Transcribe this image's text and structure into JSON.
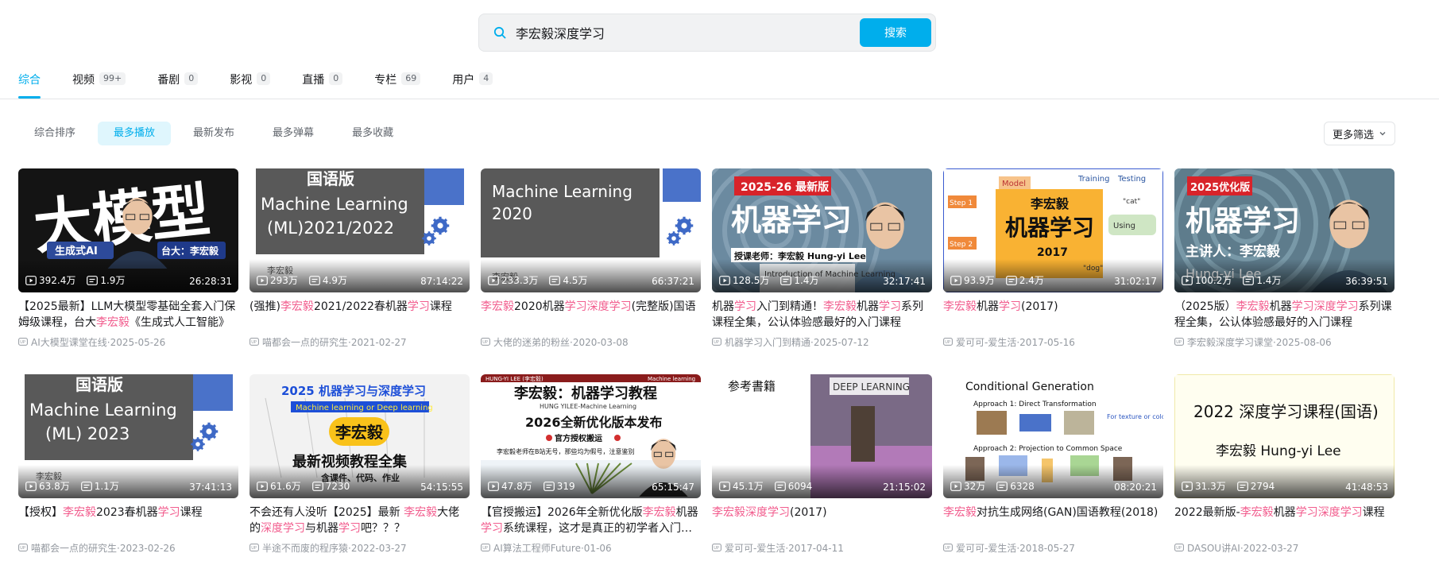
{
  "search": {
    "value": "李宏毅深度学习",
    "button": "搜索"
  },
  "tabs": [
    {
      "label": "综合",
      "count": ""
    },
    {
      "label": "视频",
      "count": "99+"
    },
    {
      "label": "番剧",
      "count": "0"
    },
    {
      "label": "影视",
      "count": "0"
    },
    {
      "label": "直播",
      "count": "0"
    },
    {
      "label": "专栏",
      "count": "69"
    },
    {
      "label": "用户",
      "count": "4"
    }
  ],
  "sort": [
    "综合排序",
    "最多播放",
    "最新发布",
    "最多弹幕",
    "最多收藏"
  ],
  "filter_label": "更多筛选",
  "colors": {
    "accent": "#00aeec",
    "highlight": "#f25d8e"
  },
  "videos": [
    {
      "views": "392.4万",
      "danmaku": "1.9万",
      "duration": "26:28:31",
      "title": [
        [
          "【2025最新】LLM大模型零基础全套入门保姆级课程，台大",
          ""
        ],
        [
          "李宏毅",
          "h"
        ],
        [
          "《生成式人工智能》",
          ""
        ]
      ],
      "uploader": "AI大模型课堂在线",
      "date": "2025-05-26",
      "thumb": {
        "bg": "#111111",
        "big": "大模型",
        "sub": "生成式AI",
        "tag": "台大：李宏毅"
      }
    },
    {
      "views": "293万",
      "danmaku": "4.9万",
      "duration": "87:14:22",
      "title": [
        [
          "(强推)",
          ""
        ],
        [
          "李宏毅",
          "h"
        ],
        [
          "2021/2022春机器",
          ""
        ],
        [
          "学习",
          "h"
        ],
        [
          "课程",
          ""
        ]
      ],
      "uploader": "喵都会一点的研究生",
      "date": "2021-02-27",
      "thumb": {
        "top": "国语版",
        "line1": "Machine Learning",
        "line2": "(ML)2021/2022",
        "caption": "李宏毅"
      }
    },
    {
      "views": "233.3万",
      "danmaku": "4.5万",
      "duration": "66:37:21",
      "title": [
        [
          "李宏毅",
          "h"
        ],
        [
          "2020机器",
          ""
        ],
        [
          "学习",
          "h"
        ],
        [
          "深度",
          "h"
        ],
        [
          "学习",
          "h"
        ],
        [
          "(完整版)国语",
          ""
        ]
      ],
      "uploader": "大佬的迷弟的粉丝",
      "date": "2020-03-08",
      "thumb": {
        "line1": "Machine Learning",
        "line2": "2020",
        "caption": "李宏毅"
      }
    },
    {
      "views": "128.5万",
      "danmaku": "1.4万",
      "duration": "32:17:41",
      "title": [
        [
          "机器",
          ""
        ],
        [
          "学习",
          "h"
        ],
        [
          "入门到精通！",
          ""
        ],
        [
          "李宏毅",
          "h"
        ],
        [
          "机器",
          ""
        ],
        [
          "学习",
          "h"
        ],
        [
          "系列课程全集，公认体验感最好的入门课程",
          ""
        ]
      ],
      "uploader": "机器学习入门到精通",
      "date": "2025-07-12",
      "thumb": {
        "badge": "2025-26 最新版",
        "big": "机器学习",
        "teacher": "授课老师：李宏毅 Hung-yi Lee",
        "intro": "Introduction of Machine Learning"
      }
    },
    {
      "views": "93.9万",
      "danmaku": "2.4万",
      "duration": "31:02:17",
      "title": [
        [
          "李宏毅",
          "h"
        ],
        [
          "机器",
          ""
        ],
        [
          "学习",
          "h"
        ],
        [
          "(2017)",
          ""
        ]
      ],
      "uploader": "爱可可-爱生活",
      "date": "2017-05-16",
      "thumb": {
        "name": "李宏毅",
        "big": "机器学习",
        "year": "2017",
        "step1": "Step 1",
        "step2": "Step 2",
        "model": "Model",
        "training": "Training",
        "testing": "Testing",
        "cat": "\"cat\"",
        "dog": "\"dog\"",
        "using": "Using"
      }
    },
    {
      "views": "100.2万",
      "danmaku": "1.4万",
      "duration": "36:39:51",
      "title": [
        [
          "（2025版）",
          ""
        ],
        [
          "李宏毅",
          "h"
        ],
        [
          "机器",
          ""
        ],
        [
          "学习",
          "h"
        ],
        [
          "深度",
          "h"
        ],
        [
          "学习",
          "h"
        ],
        [
          "系列课程全集，公认体验感最好的入门课程",
          ""
        ]
      ],
      "uploader": "李宏毅深度学习课堂",
      "date": "2025-08-06",
      "thumb": {
        "badge": "2025优化版",
        "big": "机器学习",
        "teacher": "主讲人：李宏毅",
        "en": "Hung-yi Lee"
      }
    },
    {
      "views": "63.8万",
      "danmaku": "1.1万",
      "duration": "37:41:13",
      "title": [
        [
          "【授权】",
          ""
        ],
        [
          "李宏毅",
          "h"
        ],
        [
          "2023春机器",
          ""
        ],
        [
          "学习",
          "h"
        ],
        [
          "课程",
          ""
        ]
      ],
      "uploader": "喵都会一点的研究生",
      "date": "2023-02-26",
      "thumb": {
        "top": "国语版",
        "line1": "Machine Learning",
        "line2": "(ML) 2023",
        "caption": "李宏毅"
      }
    },
    {
      "views": "61.6万",
      "danmaku": "7230",
      "duration": "54:15:55",
      "title": [
        [
          "不会还有人没听【2025】最新 ",
          ""
        ],
        [
          "李宏毅",
          "h"
        ],
        [
          "大佬的",
          ""
        ],
        [
          "深度",
          "h"
        ],
        [
          "学习",
          "h"
        ],
        [
          "与机器",
          ""
        ],
        [
          "学习",
          "h"
        ],
        [
          "吧？？？",
          ""
        ]
      ],
      "uploader": "半途不而废的程序猿",
      "date": "2022-03-27",
      "thumb": {
        "top": "2025 机器学习与深度学习",
        "sub": "Machine learning or Deep learning",
        "name": "李宏毅",
        "big": "最新视频教程全集",
        "tags": "含课件、代码、作业"
      }
    },
    {
      "views": "47.8万",
      "danmaku": "319",
      "duration": "65:15:47",
      "title": [
        [
          "【官授搬运】2026年全新优化版",
          ""
        ],
        [
          "李宏毅",
          "h"
        ],
        [
          "机器",
          ""
        ],
        [
          "学习",
          "h"
        ],
        [
          "系统课程，这才是真正的初学者入门课程",
          ""
        ]
      ],
      "uploader": "AI算法工程师Future",
      "date": "01-06",
      "thumb": {
        "header_l": "HUNG-YI LEE (李宏毅)",
        "header_r": "Machine learning",
        "big": "李宏毅：机器学习教程",
        "sub": "HUNG YILEE-Machine Learning",
        "release": "2026全新优化版本发布",
        "official": "官方授权搬运",
        "note": "李宏毅老师在B站无号，那些均为假号，注意鉴别"
      }
    },
    {
      "views": "45.1万",
      "danmaku": "6094",
      "duration": "21:15:02",
      "title": [
        [
          "李宏毅",
          "h"
        ],
        [
          "深度",
          "h"
        ],
        [
          "学习",
          "h"
        ],
        [
          "(2017)",
          ""
        ]
      ],
      "uploader": "爱可可-爱生活",
      "date": "2017-04-11",
      "thumb": {
        "heading": "参考書籍",
        "book": "DEEP LEARNING"
      }
    },
    {
      "views": "32万",
      "danmaku": "6328",
      "duration": "08:20:21",
      "title": [
        [
          "李宏毅",
          "h"
        ],
        [
          "对抗生成网络(GAN)国语教程(2018)",
          ""
        ]
      ],
      "uploader": "爱可可-爱生活",
      "date": "2018-05-27",
      "thumb": {
        "heading": "Conditional Generation",
        "a1": "Approach 1: Direct Transformation",
        "a2": "Approach 2: Projection to Common Space",
        "note": "For texture or color change"
      }
    },
    {
      "views": "31.3万",
      "danmaku": "2794",
      "duration": "41:48:53",
      "title": [
        [
          "2022最新版-",
          ""
        ],
        [
          "李宏毅",
          "h"
        ],
        [
          "机器",
          ""
        ],
        [
          "学习",
          "h"
        ],
        [
          "深度",
          "h"
        ],
        [
          "学习",
          "h"
        ],
        [
          "课程",
          ""
        ]
      ],
      "uploader": "DASOU讲AI",
      "date": "2022-03-27",
      "thumb": {
        "line1": "2022 深度学习课程(国语)",
        "line2": "李宏毅  Hung-yi Lee"
      }
    }
  ]
}
